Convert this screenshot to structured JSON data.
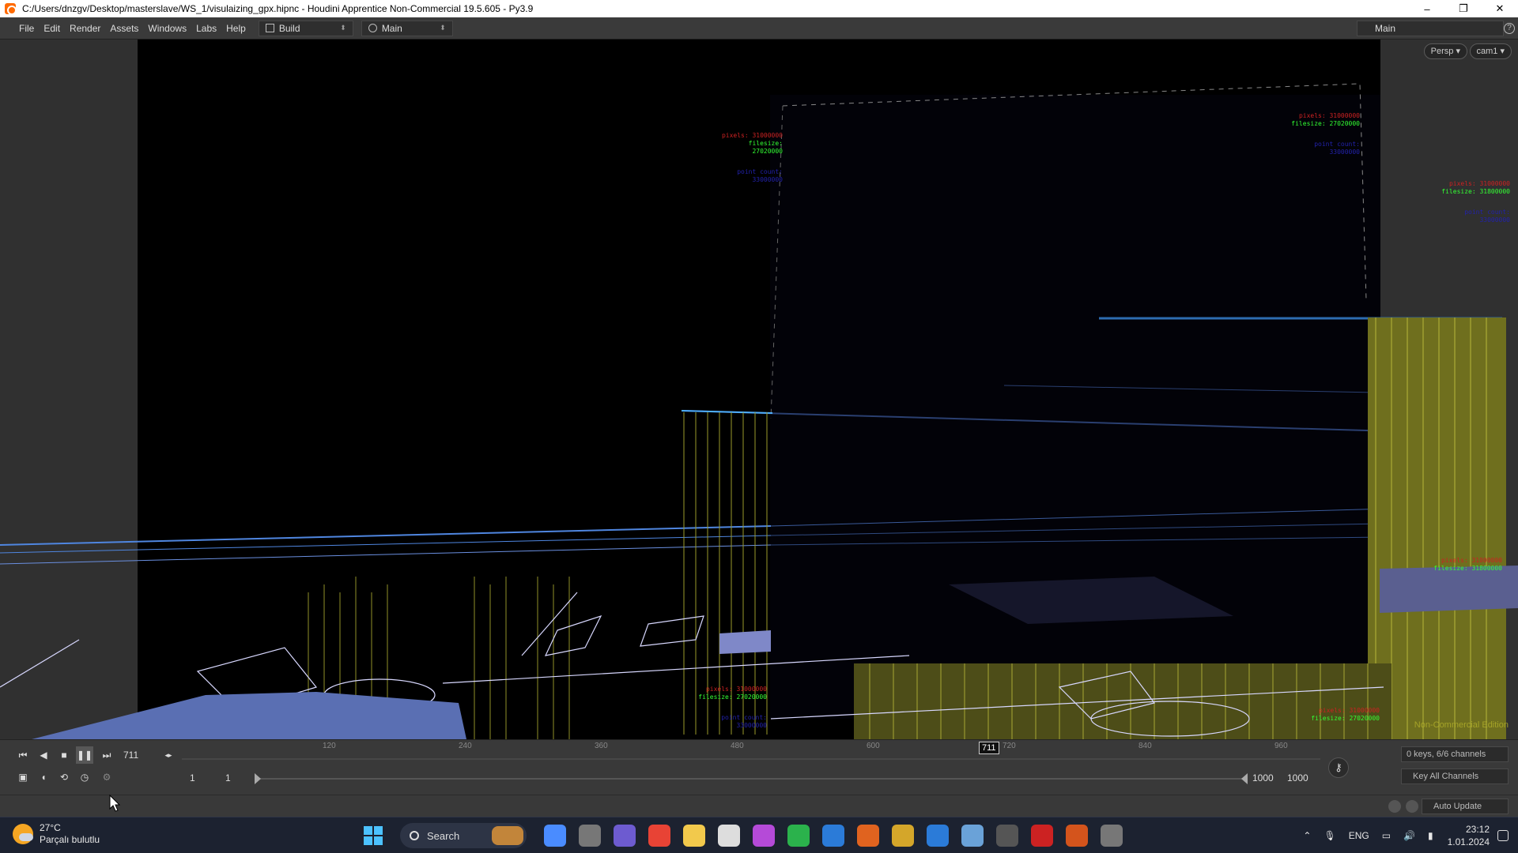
{
  "window": {
    "title": "C:/Users/dnzgv/Desktop/masterslave/WS_1/visulaizing_gpx.hipnc - Houdini Apprentice Non-Commercial 19.5.605 - Py3.9",
    "controls": [
      "–",
      "❐",
      "✕"
    ]
  },
  "menubar": {
    "items": [
      "File",
      "Edit",
      "Render",
      "Assets",
      "Windows",
      "Labs",
      "Help"
    ],
    "desktop_build": "Build",
    "desktop_main": "Main",
    "right_desktop": "Main"
  },
  "viewport": {
    "persp_label": "Persp",
    "cam_label": "cam1",
    "watermark": "Non-Commercial Edition",
    "labels": [
      {
        "pixels": "pixels: 31000000",
        "filesize": "filesize: 27020000",
        "extra": "point count: 33000000"
      },
      {
        "pixels": "pixels: 31000000",
        "filesize": "filesize: 27020000",
        "extra": "point count: 33000000"
      },
      {
        "pixels": "pixels: 31000000",
        "filesize": "filesize: 31800000",
        "extra": "point count: 33000000"
      },
      {
        "pixels": "pixels: 31000000",
        "filesize": "filesize: 27020000",
        "extra": "point count: 33000000"
      },
      {
        "pixels": "pixels: 31000000",
        "filesize": "filesize: 27020000",
        "extra": "point count: 33000000"
      },
      {
        "pixels": "pixels: 31000000",
        "filesize": "filesize: 31800000",
        "extra": "point count: 33000000"
      }
    ]
  },
  "playbar": {
    "current_frame": "711",
    "frame_marker": "711",
    "tick_labels": [
      "120",
      "240",
      "360",
      "480",
      "600",
      "720",
      "840",
      "960"
    ],
    "range_start": "1",
    "range_start2": "1",
    "range_end": "1000",
    "range_end2": "1000",
    "keys_info": "0 keys, 6/6 channels",
    "key_all": "Key All Channels",
    "auto_update": "Auto Update"
  },
  "taskbar": {
    "temperature": "27°C",
    "weather": "Parçalı bulutlu",
    "search_placeholder": "Search",
    "language": "ENG",
    "time": "23:12",
    "date": "1.01.2024",
    "apps": [
      "#4a8cff",
      "#777",
      "#6d5bd0",
      "#e84335",
      "#f2c94c",
      "#ddd",
      "#b54ad8",
      "#2bb24c",
      "#2b7bd8",
      "#e0631f",
      "#d4a62a",
      "#2b7bd8",
      "#6aa2d8",
      "#555",
      "#c22",
      "#d4541c",
      "#777"
    ],
    "accent": "#4cc2ff"
  },
  "colors": {
    "wire_yellow": "#c8c840",
    "wire_blue": "#4f86e0",
    "wire_white": "#d8d8ff",
    "panel_gray": "#303030"
  }
}
